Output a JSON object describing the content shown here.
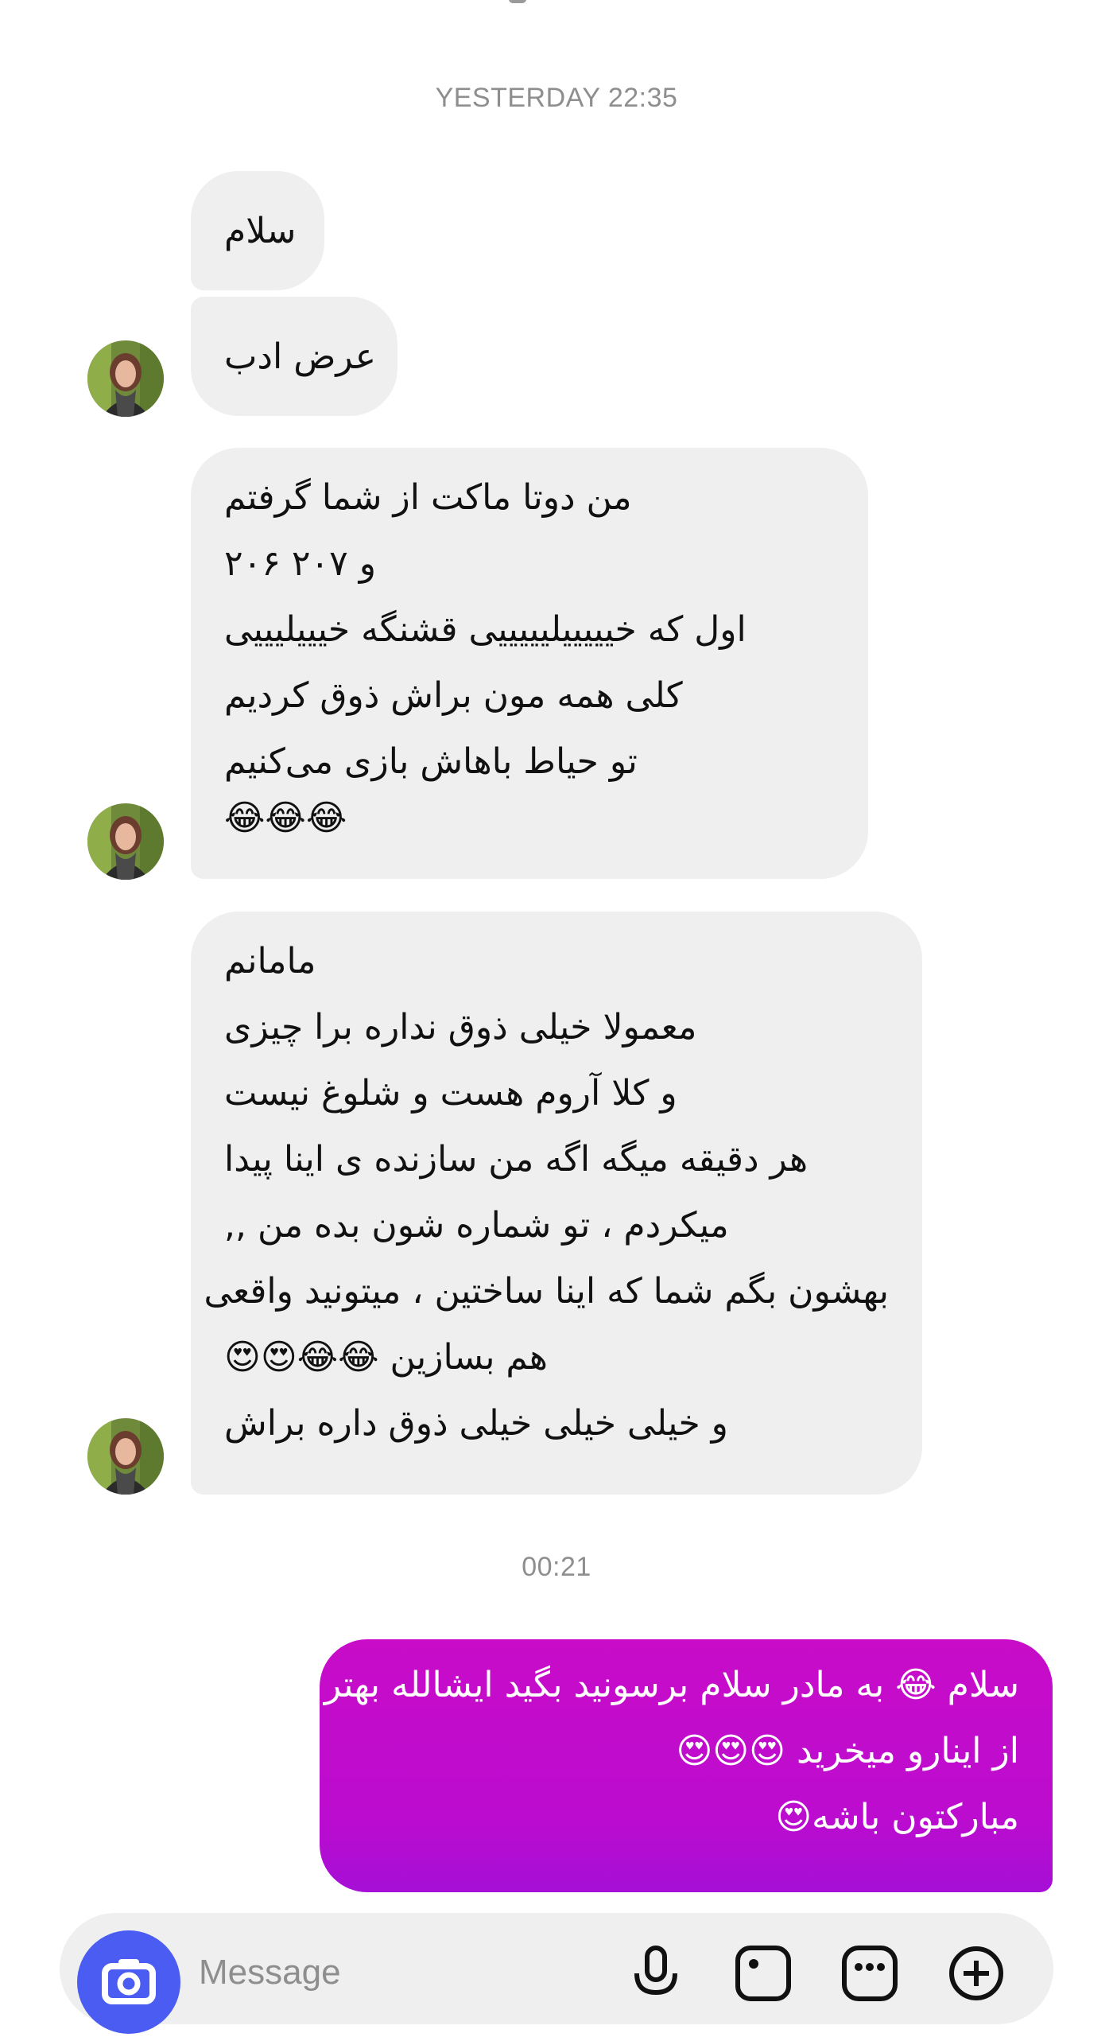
{
  "thread": {
    "timestamp_1": "YESTERDAY 22:35",
    "timestamp_2": "00:21",
    "received_messages": [
      {
        "lines": [
          "سلام"
        ]
      },
      {
        "lines": [
          "عرض ادب"
        ]
      },
      {
        "lines": [
          "من دوتا ماکت از شما گرفتم",
          "و ۲۰۷ ۲۰۶",
          "اول که خیییییلیییییی قشنگه خیییلیییی",
          "کلی همه مون براش ذوق کردیم",
          "تو حیاط باهاش بازی می‌کنیم",
          "😂😂😂"
        ]
      },
      {
        "lines": [
          "مامانم",
          "معمولا خیلی ذوق  نداره برا چیزی",
          "و کلا  آروم هست و شلوغ نیست",
          "هر دقیقه میگه اگه من سازنده ی اینا پیدا",
          "میکردم ، تو شماره شون بده من ,,",
          "بهشون بگم  شما که اینا ساختین ، میتونید واقعی",
          "هم بسازین 😂😂😍😍",
          "و خیلی خیلی خیلی ذوق داره براش"
        ]
      }
    ],
    "sent_messages": [
      {
        "lines": [
          "سلام 😂 به مادر سلام برسونید بگید ایشالله بهتر",
          "از اینارو میخرید 😍😍😍",
          "مبارکتون باشه😍"
        ]
      }
    ]
  },
  "composer": {
    "placeholder": "Message",
    "icons": [
      "camera-icon",
      "microphone-icon",
      "gallery-icon",
      "sticker-icon",
      "plus-icon"
    ],
    "camera_button_color": "#4a5cf2"
  },
  "colors": {
    "received_bubble": "#efefef",
    "sent_bubble": "#c20ccb",
    "timestamp": "#8e8e8e"
  }
}
